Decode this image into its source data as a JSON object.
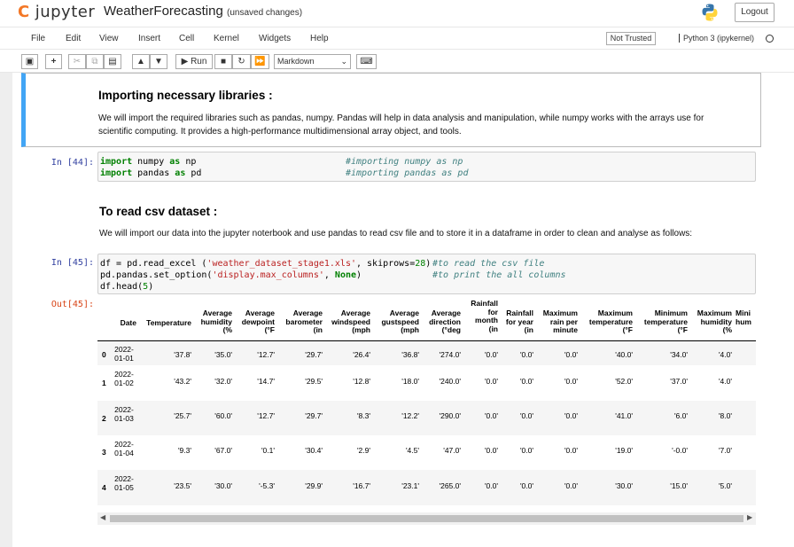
{
  "header": {
    "logo_text": "jupyter",
    "notebook_name": "WeatherForecasting",
    "save_status": "(unsaved changes)",
    "logout_label": "Logout"
  },
  "menubar": {
    "items": [
      "File",
      "Edit",
      "View",
      "Insert",
      "Cell",
      "Kernel",
      "Widgets",
      "Help"
    ],
    "trusted_label": "Not Trusted",
    "kernel_label": "Python 3 (ipykernel)"
  },
  "toolbar": {
    "run_label": "Run",
    "cell_type": "Markdown"
  },
  "cells": {
    "md1": {
      "heading": "Importing necessary libraries :",
      "text_line1": "We will import the required libraries such as pandas, numpy. Pandas will help in data analysis and manipulation, while numpy works with the arrays use for",
      "text_line2": "scientific computing. It provides a high-performance multidimensional array object, and tools."
    },
    "code1": {
      "prompt": "In [44]:",
      "line1_kw1": "import",
      "line1_mod": " numpy ",
      "line1_kw2": "as",
      "line1_alias": " np",
      "line1_comment": "#importing numpy as np",
      "line2_kw1": "import",
      "line2_mod": " pandas ",
      "line2_kw2": "as",
      "line2_alias": " pd",
      "line2_comment": "#importing pandas as pd"
    },
    "md2": {
      "heading": "To read csv dataset :",
      "text": "We will import our data into the jupyter noterbook and use pandas to read csv file and to store it in a dataframe in order to clean and analyse as follows:"
    },
    "code2": {
      "prompt": "In [45]:",
      "line1_a": "df = pd.read_excel (",
      "line1_str": "'weather_dataset_stage1.xls'",
      "line1_b": ", skiprows=",
      "line1_num": "28",
      "line1_c": ")",
      "line1_comment": "#to read the csv file",
      "line2_a": "pd.pandas.set_option(",
      "line2_str": "'display.max_columns'",
      "line2_b": ", ",
      "line2_kc": "None",
      "line2_c": ")",
      "line2_comment": "#to print the all columns",
      "line3_a": "df.head(",
      "line3_num": "5",
      "line3_c": ")"
    },
    "out2": {
      "prompt": "Out[45]:"
    }
  },
  "dataframe": {
    "columns": [
      "Date",
      "Temperature",
      "Average humidity (%",
      "Average dewpoint (°F",
      "Average barometer (in",
      "Average windspeed (mph",
      "Average gustspeed (mph",
      "Average direction (°deg",
      "Rainfall for month (in",
      "Rainfall for year (in",
      "Maximum rain per minute",
      "Maximum temperature (°F",
      "Minimum temperature (°F",
      "Maximum humidity (%",
      "Mini hum"
    ],
    "rows": [
      {
        "index": "0",
        "date": "2022-01-01",
        "values": [
          "'37.8'",
          "'35.0'",
          "'12.7'",
          "'29.7'",
          "'26.4'",
          "'36.8'",
          "'274.0'",
          "'0.0'",
          "'0.0'",
          "'0.0'",
          "'40.0'",
          "'34.0'",
          "'4.0'"
        ]
      },
      {
        "index": "1",
        "date": "2022-01-02",
        "values": [
          "'43.2'",
          "'32.0'",
          "'14.7'",
          "'29.5'",
          "'12.8'",
          "'18.0'",
          "'240.0'",
          "'0.0'",
          "'0.0'",
          "'0.0'",
          "'52.0'",
          "'37.0'",
          "'4.0'"
        ]
      },
      {
        "index": "2",
        "date": "2022-01-03",
        "values": [
          "'25.7'",
          "'60.0'",
          "'12.7'",
          "'29.7'",
          "'8.3'",
          "'12.2'",
          "'290.0'",
          "'0.0'",
          "'0.0'",
          "'0.0'",
          "'41.0'",
          "'6.0'",
          "'8.0'"
        ]
      },
      {
        "index": "3",
        "date": "2022-01-04",
        "values": [
          "'9.3'",
          "'67.0'",
          "'0.1'",
          "'30.4'",
          "'2.9'",
          "'4.5'",
          "'47.0'",
          "'0.0'",
          "'0.0'",
          "'0.0'",
          "'19.0'",
          "'-0.0'",
          "'7.0'"
        ]
      },
      {
        "index": "4",
        "date": "2022-01-05",
        "values": [
          "'23.5'",
          "'30.0'",
          "'-5.3'",
          "'29.9'",
          "'16.7'",
          "'23.1'",
          "'265.0'",
          "'0.0'",
          "'0.0'",
          "'0.0'",
          "'30.0'",
          "'15.0'",
          "'5.0'"
        ]
      }
    ]
  }
}
